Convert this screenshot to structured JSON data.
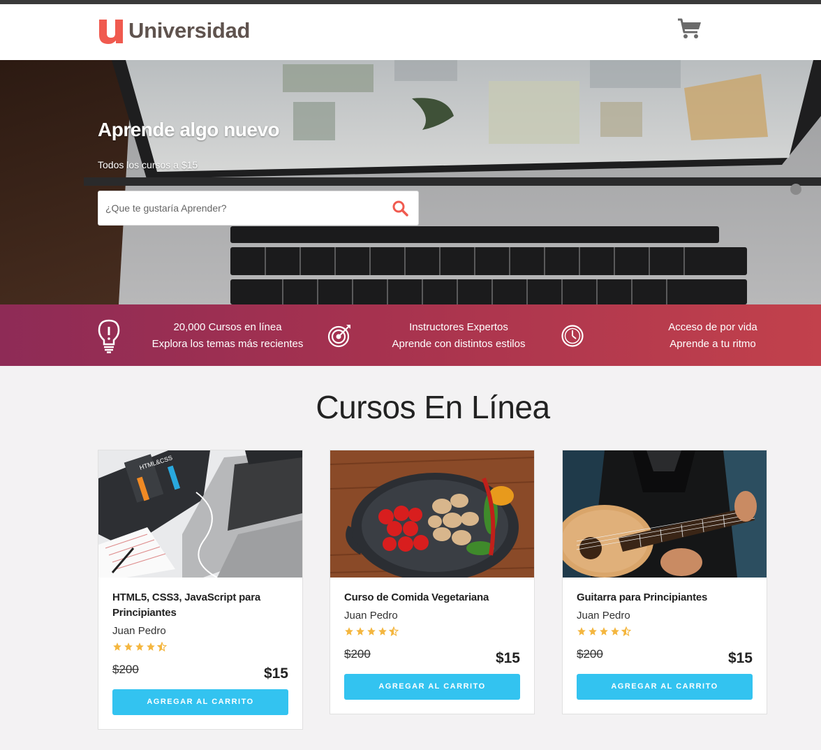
{
  "header": {
    "logo_text": "Universidad",
    "brand_color": "#f05a4f",
    "logo_text_color": "#5f534e"
  },
  "hero": {
    "title": "Aprende algo nuevo",
    "subtitle": "Todos los cursos a $15",
    "search_placeholder": "¿Que te gustaría Aprender?",
    "search_icon": "search-icon"
  },
  "features": [
    {
      "icon": "lightbulb-icon",
      "line1": "20,000 Cursos en línea",
      "line2": "Explora los temas más recientes"
    },
    {
      "icon": "target-icon",
      "line1": "Instructores Expertos",
      "line2": "Aprende con distintos estilos"
    },
    {
      "icon": "clock-icon",
      "line1": "Acceso de por vida",
      "line2": "Aprende a tu ritmo"
    }
  ],
  "section_title": "Cursos En Línea",
  "courses": [
    {
      "title": "HTML5, CSS3, JavaScript para Principiantes",
      "author": "Juan Pedro",
      "rating": 4.5,
      "old_price": "$200",
      "price": "$15",
      "button": "AGREGAR AL CARRITO"
    },
    {
      "title": "Curso de Comida Vegetariana",
      "author": "Juan Pedro",
      "rating": 4.5,
      "old_price": "$200",
      "price": "$15",
      "button": "AGREGAR AL CARRITO"
    },
    {
      "title": "Guitarra para Principiantes",
      "author": "Juan Pedro",
      "rating": 4.5,
      "old_price": "$200",
      "price": "$15",
      "button": "AGREGAR AL CARRITO"
    }
  ],
  "colors": {
    "accent_button": "#33c3f0",
    "star": "#f4b63f",
    "band_start": "#8e2b56",
    "band_end": "#c2414c",
    "search_icon": "#f05a4f"
  }
}
